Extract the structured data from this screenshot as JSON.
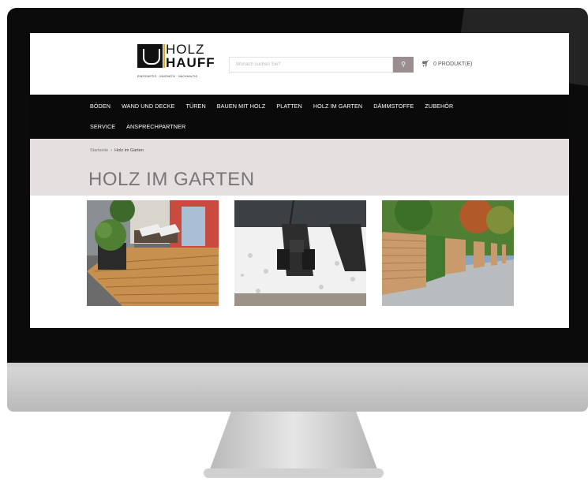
{
  "logo": {
    "line1": "HOLZ",
    "line2": "HAUFF",
    "tagline": "EINZIGARTIG · INNOVATIV · NACHHALTIG"
  },
  "search": {
    "placeholder": "Wonach suchen Sie?",
    "button_icon": "search-icon"
  },
  "cart": {
    "icon": "cart-icon",
    "label": "0 PRODUKT(E)"
  },
  "nav": {
    "row1": [
      "BÖDEN",
      "WAND UND DECKE",
      "TÜREN",
      "BAUEN MIT HOLZ",
      "PLATTEN",
      "HOLZ IM GARTEN",
      "DÄMMSTOFFE",
      "ZUBEHÖR"
    ],
    "row2": [
      "SERVICE",
      "ANSPRECHPARTNER"
    ]
  },
  "breadcrumb": {
    "home": "Startseite",
    "separator": "›",
    "current": "Holz im Garten"
  },
  "page": {
    "title": "HOLZ IM GARTEN"
  },
  "tiles": [
    {
      "subject": "wooden deck with planter and lounge chairs"
    },
    {
      "subject": "terrace substructure on gravel"
    },
    {
      "subject": "wooden privacy fence along hedge"
    }
  ],
  "colors": {
    "nav_bg": "#0a0a0a",
    "banner_bg": "#e6dfdf",
    "search_button": "#9a8e8e",
    "title": "#777777",
    "logo_accent": "#e3a21a"
  }
}
